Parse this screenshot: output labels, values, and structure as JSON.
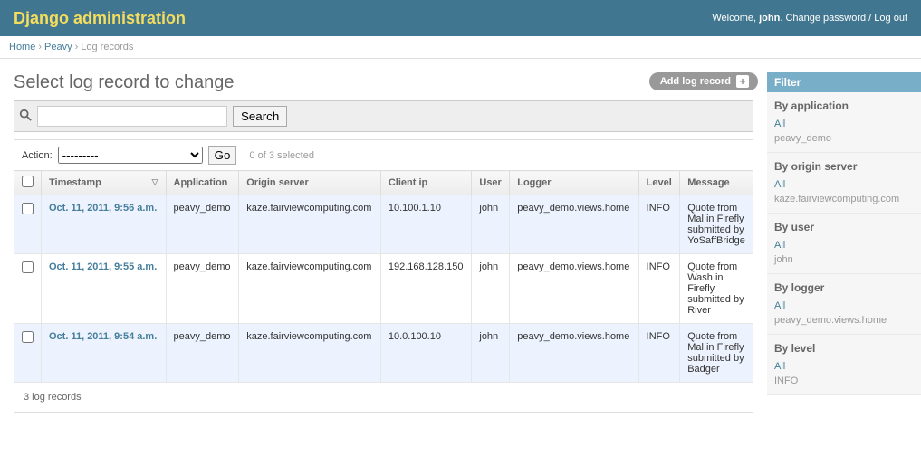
{
  "header": {
    "site_title": "Django administration",
    "welcome_prefix": "Welcome, ",
    "username": "john",
    "change_password": "Change password",
    "log_out": "Log out"
  },
  "breadcrumbs": {
    "home": "Home",
    "app": "Peavy",
    "current": "Log records"
  },
  "page_title": "Select log record to change",
  "object_tools": {
    "add_label": "Add log record"
  },
  "search": {
    "placeholder": "",
    "button": "Search"
  },
  "actions": {
    "label": "Action:",
    "placeholder": "---------",
    "go": "Go",
    "counter": "0 of 3 selected"
  },
  "columns": {
    "timestamp": "Timestamp",
    "application": "Application",
    "origin_server": "Origin server",
    "client_ip": "Client ip",
    "user": "User",
    "logger": "Logger",
    "level": "Level",
    "message": "Message"
  },
  "rows": [
    {
      "timestamp": "Oct. 11, 2011, 9:56 a.m.",
      "application": "peavy_demo",
      "origin_server": "kaze.fairviewcomputing.com",
      "client_ip": "10.100.1.10",
      "user": "john",
      "logger": "peavy_demo.views.home",
      "level": "INFO",
      "message": "Quote from Mal in Firefly submitted by YoSaffBridge"
    },
    {
      "timestamp": "Oct. 11, 2011, 9:55 a.m.",
      "application": "peavy_demo",
      "origin_server": "kaze.fairviewcomputing.com",
      "client_ip": "192.168.128.150",
      "user": "john",
      "logger": "peavy_demo.views.home",
      "level": "INFO",
      "message": "Quote from Wash in Firefly submitted by River"
    },
    {
      "timestamp": "Oct. 11, 2011, 9:54 a.m.",
      "application": "peavy_demo",
      "origin_server": "kaze.fairviewcomputing.com",
      "client_ip": "10.0.100.10",
      "user": "john",
      "logger": "peavy_demo.views.home",
      "level": "INFO",
      "message": "Quote from Mal in Firefly submitted by Badger"
    }
  ],
  "paginator": "3 log records",
  "filter": {
    "heading": "Filter",
    "groups": [
      {
        "title": "By application",
        "items": [
          {
            "label": "All",
            "selected": true
          },
          {
            "label": "peavy_demo",
            "selected": false
          }
        ]
      },
      {
        "title": "By origin server",
        "items": [
          {
            "label": "All",
            "selected": true
          },
          {
            "label": "kaze.fairviewcomputing.com",
            "selected": false
          }
        ]
      },
      {
        "title": "By user",
        "items": [
          {
            "label": "All",
            "selected": true
          },
          {
            "label": "john",
            "selected": false
          }
        ]
      },
      {
        "title": "By logger",
        "items": [
          {
            "label": "All",
            "selected": true
          },
          {
            "label": "peavy_demo.views.home",
            "selected": false
          }
        ]
      },
      {
        "title": "By level",
        "items": [
          {
            "label": "All",
            "selected": true
          },
          {
            "label": "INFO",
            "selected": false
          }
        ]
      }
    ]
  }
}
